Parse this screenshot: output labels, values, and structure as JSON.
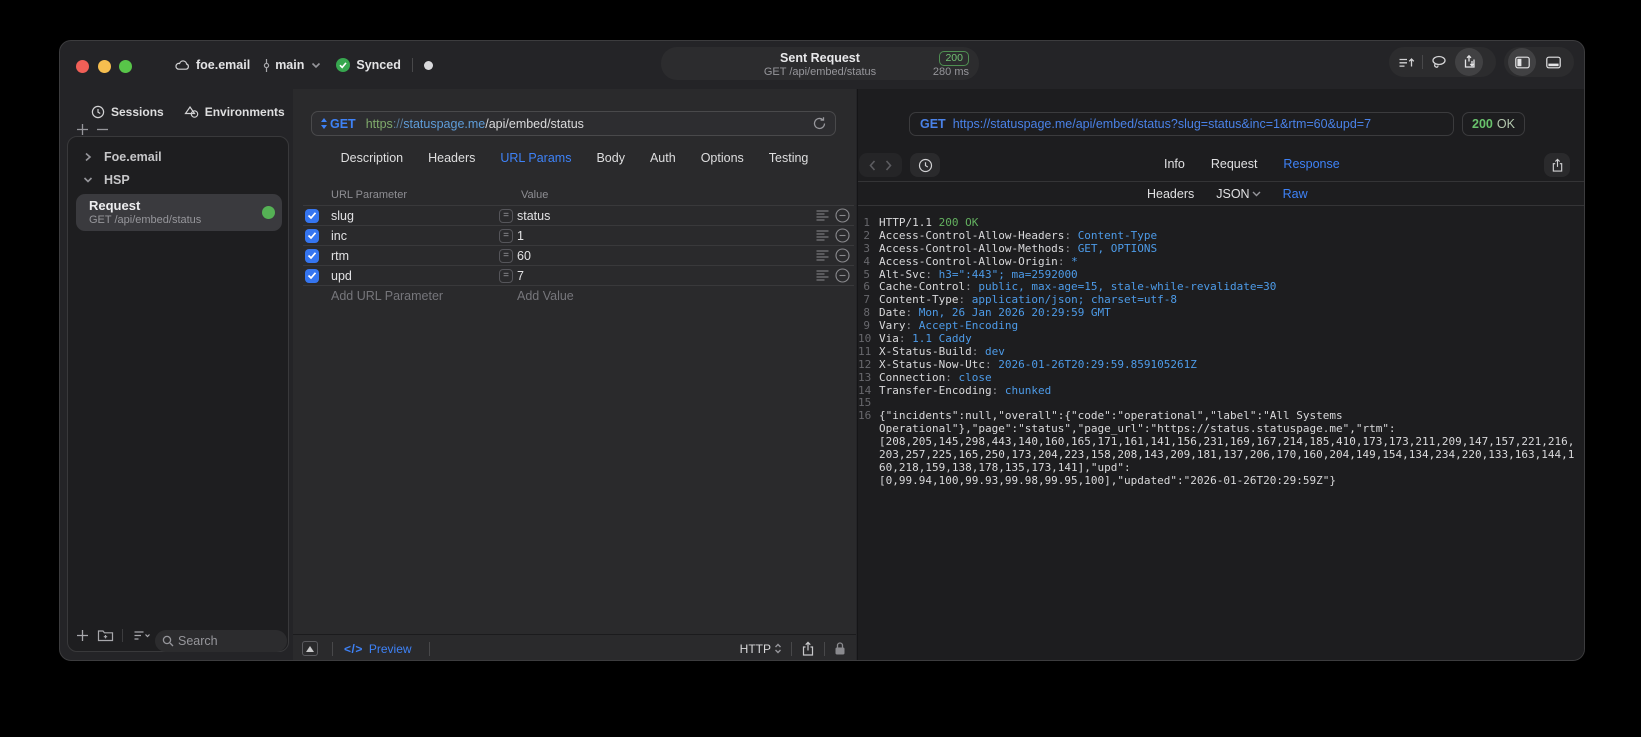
{
  "colors": {
    "accent_blue": "#3E82F7",
    "value_blue": "#4D9BE8",
    "status_green": "#63B05F",
    "checkbox_blue": "#3575F0",
    "traffic_red": "#F05F57",
    "traffic_yellow": "#F6BE4F",
    "traffic_green": "#58C549",
    "sync_green": "#37A74F",
    "dot_green": "#55B155"
  },
  "titlebar": {
    "project": "foe.email",
    "branch": "main",
    "sync_status": "Synced",
    "title": "Sent Request",
    "title_status": "200",
    "subtitle": "GET /api/embed/status",
    "subtitle_time": "280 ms"
  },
  "sidebar": {
    "tab_sessions": "Sessions",
    "tab_environments": "Environments",
    "tree_item_1": "Foe.email",
    "tree_item_2": "HSP",
    "request_item": {
      "title": "Request",
      "subtitle": "GET /api/embed/status"
    },
    "search_placeholder": "Search"
  },
  "request_editor": {
    "method": "GET",
    "url_scheme": "https",
    "url_sep": "://",
    "url_host": "statuspage.me",
    "url_path": "/api/embed/status",
    "tabs": [
      "Description",
      "Headers",
      "URL Params",
      "Body",
      "Auth",
      "Options",
      "Testing"
    ],
    "active_tab": "URL Params",
    "param_columns": [
      "URL Parameter",
      "Value"
    ],
    "params": [
      {
        "enabled": true,
        "name": "slug",
        "value": "status"
      },
      {
        "enabled": true,
        "name": "inc",
        "value": "1"
      },
      {
        "enabled": true,
        "name": "rtm",
        "value": "60"
      },
      {
        "enabled": true,
        "name": "upd",
        "value": "7"
      }
    ],
    "add_param_label": "Add URL Parameter",
    "add_value_label": "Add Value",
    "code_glyph": "</>",
    "preview_label": "Preview",
    "protocol_selector": "HTTP"
  },
  "response_panel": {
    "method": "GET",
    "url": "https://statuspage.me/api/embed/status?slug=status&inc=1&rtm=60&upd=7",
    "status_code": "200",
    "status_text": "OK",
    "tabs": [
      "Info",
      "Request",
      "Response"
    ],
    "active_tab": "Response",
    "subtabs": [
      "Headers",
      "JSON",
      "Raw"
    ],
    "active_subtab": "Raw",
    "status_line": {
      "protocol": "HTTP/1.1 ",
      "status": "200 OK"
    },
    "headers": [
      {
        "name": "Access-Control-Allow-Headers",
        "value": "Content-Type"
      },
      {
        "name": "Access-Control-Allow-Methods",
        "value": "GET, OPTIONS"
      },
      {
        "name": "Access-Control-Allow-Origin",
        "value": "*"
      },
      {
        "name": "Alt-Svc",
        "value": "h3=\":443\"; ma=2592000"
      },
      {
        "name": "Cache-Control",
        "value": "public, max-age=15, stale-while-revalidate=30"
      },
      {
        "name": "Content-Type",
        "value": "application/json; charset=utf-8"
      },
      {
        "name": "Date",
        "value": "Mon, 26 Jan 2026 20:29:59 GMT"
      },
      {
        "name": "Vary",
        "value": "Accept-Encoding"
      },
      {
        "name": "Via",
        "value": "1.1 Caddy"
      },
      {
        "name": "X-Status-Build",
        "value": "dev"
      },
      {
        "name": "X-Status-Now-Utc",
        "value": "2026-01-26T20:29:59.859105261Z"
      },
      {
        "name": "Connection",
        "value": "close"
      },
      {
        "name": "Transfer-Encoding",
        "value": "chunked"
      }
    ],
    "blank_line_number": "15",
    "body_line_number": "16",
    "body_rows": [
      "{\"incidents\":null,\"overall\":{\"code\":\"operational\",\"label\":\"All Systems",
      "Operational\"},\"page\":\"status\",\"page_url\":\"https://status.statuspage.me\",\"rtm\":",
      "[208,205,145,298,443,140,160,165,171,161,141,156,231,169,167,214,185,410,173,173,211,209,147,157,221,216,",
      "203,257,225,165,250,173,204,223,158,208,143,209,181,137,206,170,160,204,149,154,134,234,220,133,163,144,1",
      "60,218,159,138,178,135,173,141],\"upd\":",
      "[0,99.94,100,99.93,99.98,99.95,100],\"updated\":\"2026-01-26T20:29:59Z\"}"
    ]
  }
}
